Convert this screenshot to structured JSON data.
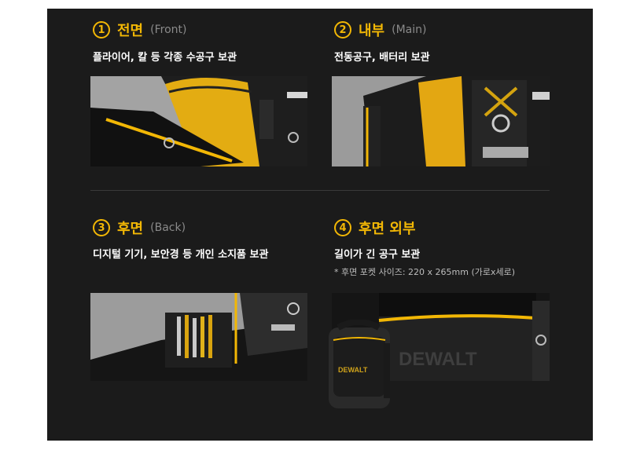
{
  "sections": [
    {
      "num": "1",
      "title": "전면",
      "en": "(Front)",
      "desc": "플라이어, 칼 등 각종 수공구 보관"
    },
    {
      "num": "2",
      "title": "내부",
      "en": "(Main)",
      "desc": "전동공구, 배터리 보관"
    },
    {
      "num": "3",
      "title": "후면",
      "en": "(Back)",
      "desc": "디지털 기기, 보안경 등 개인 소지품 보관"
    },
    {
      "num": "4",
      "title": "후면 외부",
      "en": "",
      "desc": "길이가 긴 공구 보관",
      "note": "* 후면 포켓 사이즈: 220 x 265mm (가로x세로)"
    }
  ],
  "brand": {
    "logo": "DEWALT"
  },
  "colors": {
    "accent": "#f2b705",
    "panel": "#1b1b1b"
  }
}
